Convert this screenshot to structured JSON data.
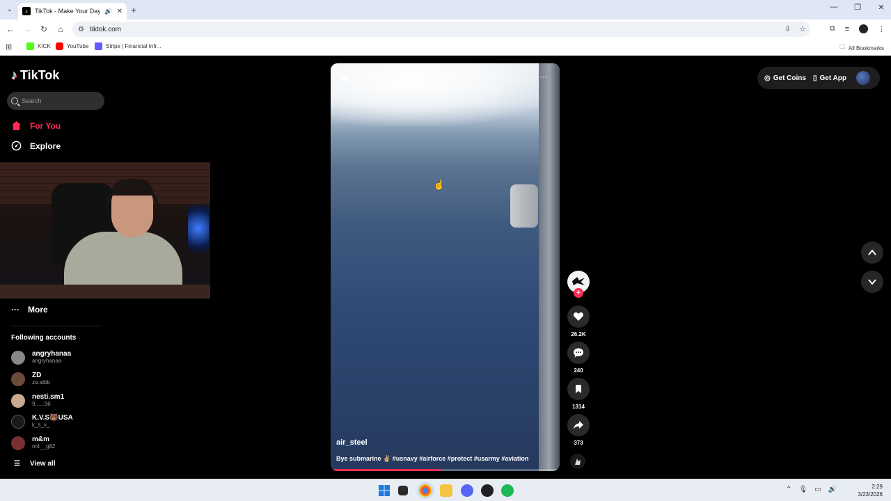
{
  "browser": {
    "tab_title": "TikTok - Make Your Day",
    "url": "tiktok.com",
    "bookmarks": [
      {
        "label": "KICK",
        "color": "#53fc18"
      },
      {
        "label": "YouTube",
        "color": "#ff0000"
      },
      {
        "label": "Stripe | Financial Infr...",
        "color": "#635bff"
      }
    ],
    "all_bookmarks": "All Bookmarks"
  },
  "sidebar": {
    "logo": "TikTok",
    "search_placeholder": "Search",
    "nav": [
      {
        "label": "For You",
        "icon": "home-icon",
        "active": true
      },
      {
        "label": "Explore",
        "icon": "compass-icon",
        "active": false
      }
    ],
    "more_label": "More",
    "following_title": "Following accounts",
    "accounts": [
      {
        "name": "angryhanaa",
        "handle": "angryhanaa",
        "color": "#888888"
      },
      {
        "name": "ZD",
        "handle": "za.albb",
        "color": "#6b4a3a"
      },
      {
        "name": "nesti.sm1",
        "handle": "9......96",
        "color": "#c9a98f"
      },
      {
        "name": "K.V.S🐻USA",
        "handle": "k_s_v_",
        "color": "#1a1a1a"
      },
      {
        "name": "m&m",
        "handle": "m4__g82",
        "color": "#7a3030"
      }
    ],
    "view_all": "View all"
  },
  "video": {
    "username": "air_steel",
    "caption": "Bye submarine ✌🏼 #usnavy #airforce #protect #usarmy #aviation",
    "progress": 0.48
  },
  "actions": {
    "likes": "26.2K",
    "comments": "240",
    "saves": "1314",
    "shares": "373"
  },
  "topbar": {
    "get_coins": "Get Coins",
    "get_app": "Get App"
  },
  "taskbar": {
    "time": "2:29",
    "date": "3/23/2026"
  },
  "colors": {
    "accent": "#fe2c55",
    "background": "#000000"
  }
}
